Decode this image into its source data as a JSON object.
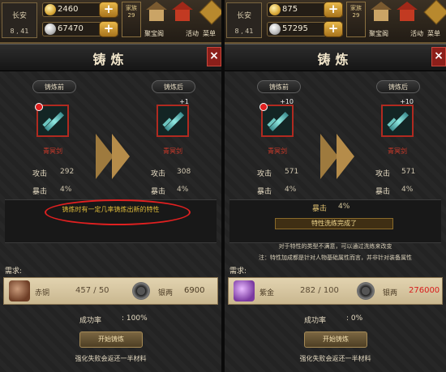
{
  "panels": [
    {
      "location": {
        "name": "长安",
        "coords": "8 , 41"
      },
      "gold": "2460",
      "silver": "67470",
      "flag_text": "家族 29",
      "nav": {
        "treasure": "聚宝阁",
        "event": "活动",
        "menu": "菜单"
      },
      "title": "铸炼",
      "close": "×",
      "before": {
        "header": "铸炼前",
        "level": "",
        "name": "青冥剑",
        "atk_label": "攻击",
        "atk": "292",
        "crit_label": "暴击",
        "crit": "4%"
      },
      "after": {
        "header": "铸炼后",
        "level": "+1",
        "name": "青冥剑",
        "atk_label": "攻击",
        "atk": "308",
        "crit_label": "暴击",
        "crit": "4%"
      },
      "hint": "铸炼时有一定几率铸炼出新的特性",
      "requirement_label": "需求:",
      "material": {
        "name": "赤铜",
        "count": "457 / 50"
      },
      "money": {
        "label": "银两",
        "value": "6900"
      },
      "success": {
        "label": "成功率",
        "value": ": 100%"
      },
      "button": "开始铸炼",
      "footer": "强化失败会返还一半材料"
    },
    {
      "location": {
        "name": "长安",
        "coords": "8 , 41"
      },
      "gold": "875",
      "silver": "57295",
      "flag_text": "家族 29",
      "nav": {
        "treasure": "聚宝阁",
        "event": "活动",
        "menu": "菜单"
      },
      "title": "铸炼",
      "close": "×",
      "before": {
        "header": "铸炼前",
        "level": "+10",
        "name": "青冥剑",
        "atk_label": "攻击",
        "atk": "571",
        "crit_label": "暴击",
        "crit": "4%"
      },
      "after": {
        "header": "铸炼后",
        "level": "+10",
        "name": "青冥剑",
        "atk_label": "攻击",
        "atk": "571",
        "crit_label": "暴击",
        "crit": "4%"
      },
      "result_crit_label": "暴击",
      "result_crit_value": "4%",
      "trait_message": "特性洗练完成了",
      "note1": "对于特性的类型不满意，可以通过洗练来改变",
      "note2": "注：特性加成都是针对人物基础属性而言，并非针对装备属性",
      "requirement_label": "需求:",
      "material": {
        "name": "紫金",
        "count": "282 / 100"
      },
      "money": {
        "label": "银两",
        "value": "276000"
      },
      "success": {
        "label": "成功率",
        "value": ": 0%"
      },
      "button": "开始铸炼",
      "footer": "强化失败会返还一半材料"
    }
  ]
}
